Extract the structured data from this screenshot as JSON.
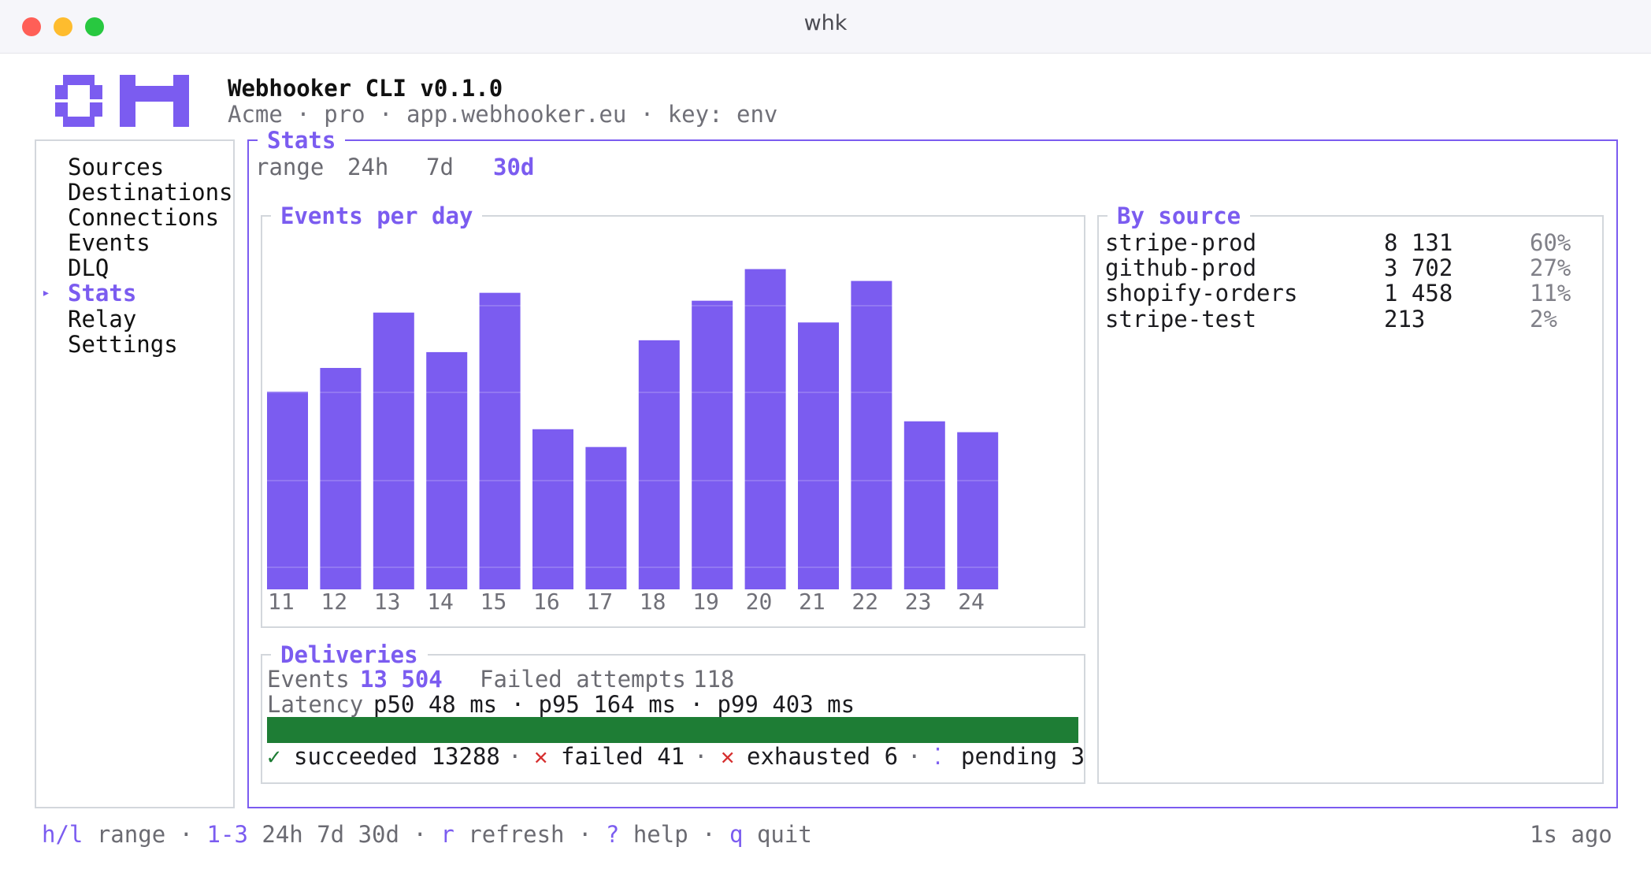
{
  "window": {
    "title": "whk"
  },
  "header": {
    "app_title": "Webhooker CLI v0.1.0",
    "subtitle": "Acme · pro · app.webhooker.eu · key: env"
  },
  "sidebar": {
    "items": [
      {
        "label": "Sources",
        "active": false
      },
      {
        "label": "Destinations",
        "active": false
      },
      {
        "label": "Connections",
        "active": false
      },
      {
        "label": "Events",
        "active": false
      },
      {
        "label": "DLQ",
        "active": false
      },
      {
        "label": "Stats",
        "active": true
      },
      {
        "label": "Relay",
        "active": false
      },
      {
        "label": "Settings",
        "active": false
      }
    ],
    "active_marker": "▸"
  },
  "stats_panel": {
    "title": "Stats",
    "range_label": "range",
    "range_options": [
      "24h",
      "7d",
      "30d"
    ],
    "range_selected": "30d"
  },
  "events_chart": {
    "title": "Events per day"
  },
  "chart_data": {
    "type": "bar",
    "title": "Events per day",
    "categories": [
      "11",
      "12",
      "13",
      "14",
      "15",
      "16",
      "17",
      "18",
      "19",
      "20",
      "21",
      "22",
      "23",
      "24"
    ],
    "values": [
      1000,
      1120,
      1400,
      1200,
      1500,
      810,
      720,
      1260,
      1460,
      1620,
      1350,
      1560,
      850,
      795
    ],
    "ylim": [
      0,
      1650
    ],
    "grid": false,
    "color": "#7b5cf0"
  },
  "by_source": {
    "title": "By source",
    "rows": [
      {
        "name": "stripe-prod",
        "count": "8 131",
        "pct": "60%"
      },
      {
        "name": "github-prod",
        "count": "3 702",
        "pct": "27%"
      },
      {
        "name": "shopify-orders",
        "count": "1 458",
        "pct": "11%"
      },
      {
        "name": "stripe-test",
        "count": "213",
        "pct": "2%"
      }
    ]
  },
  "deliveries": {
    "title": "Deliveries",
    "events_label": "Events",
    "events_value": "13 504",
    "failed_label": "Failed attempts",
    "failed_value": "118",
    "latency_label": "Latency",
    "latency_value": "p50 48 ms · p95 164 ms · p99 403 ms",
    "bar_color": "#1e7d35",
    "succeeded_fraction": 0.984,
    "statuses": {
      "succeeded_icon": "✓",
      "succeeded": "succeeded 13288",
      "failed_icon": "✕",
      "failed": "failed 41",
      "exhausted_icon": "✕",
      "exhausted": "exhausted 6",
      "pending_icon": "⁚",
      "pending": "pending 3",
      "sep": "·"
    }
  },
  "footer": {
    "k1": "h/l",
    "t1": " range ",
    "s1": "·",
    "k2": " 1-3",
    "t2": " 24h 7d 30d ",
    "s2": "·",
    "k3": " r",
    "t3": " refresh ",
    "s3": "·",
    "k4": " ?",
    "t4": " help ",
    "s4": "·",
    "k5": " q",
    "t5": " quit",
    "updated": "1s ago"
  },
  "colors": {
    "accent": "#7b5cf0",
    "success": "#1e7d35",
    "error": "#d62f2f"
  }
}
